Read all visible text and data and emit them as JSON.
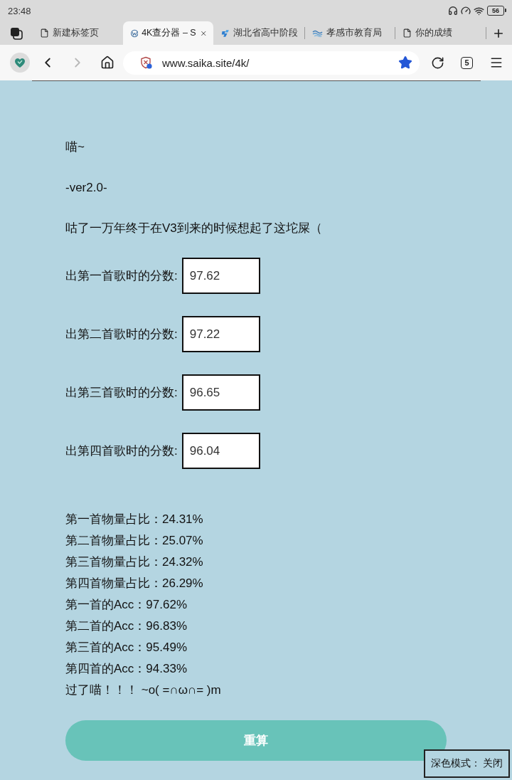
{
  "status_bar": {
    "time": "23:48",
    "battery": "56"
  },
  "browser": {
    "tabs": [
      {
        "kind": "document",
        "title": "新建标签页",
        "selected": false
      },
      {
        "kind": "circle-logo",
        "title": "4K查分器 – S",
        "selected": true
      },
      {
        "kind": "logo",
        "title": "湖北省高中阶段",
        "selected": false
      },
      {
        "kind": "wave-logo",
        "title": "孝感市教育局",
        "selected": false
      },
      {
        "kind": "document",
        "title": "你的成绩",
        "selected": false
      }
    ],
    "forward_disabled": true,
    "address": "www.saika.site/4k/",
    "bookmarked": true,
    "tab_count": "5"
  },
  "page": {
    "greeting": "喵~",
    "version": "-ver2.0-",
    "note": "咕了一万年终于在V3到来的时候想起了这坨屎（",
    "score_inputs": [
      {
        "label": "出第一首歌时的分数:",
        "value": "97.62"
      },
      {
        "label": "出第二首歌时的分数:",
        "value": "97.22"
      },
      {
        "label": "出第三首歌时的分数:",
        "value": "96.65"
      },
      {
        "label": "出第四首歌时的分数:",
        "value": "96.04"
      }
    ],
    "results": [
      "第一首物量占比：24.31%",
      "第二首物量占比：25.07%",
      "第三首物量占比：24.32%",
      "第四首物量占比：26.29%",
      "第一首的Acc：97.62%",
      "第二首的Acc：96.83%",
      "第三首的Acc：95.49%",
      "第四首的Acc：94.33%",
      "过了喵！！！ ~o( =∩ω∩= )m"
    ],
    "recalculate_button": "重算"
  },
  "dark_mode_toggle": "深色模式： 关闭"
}
